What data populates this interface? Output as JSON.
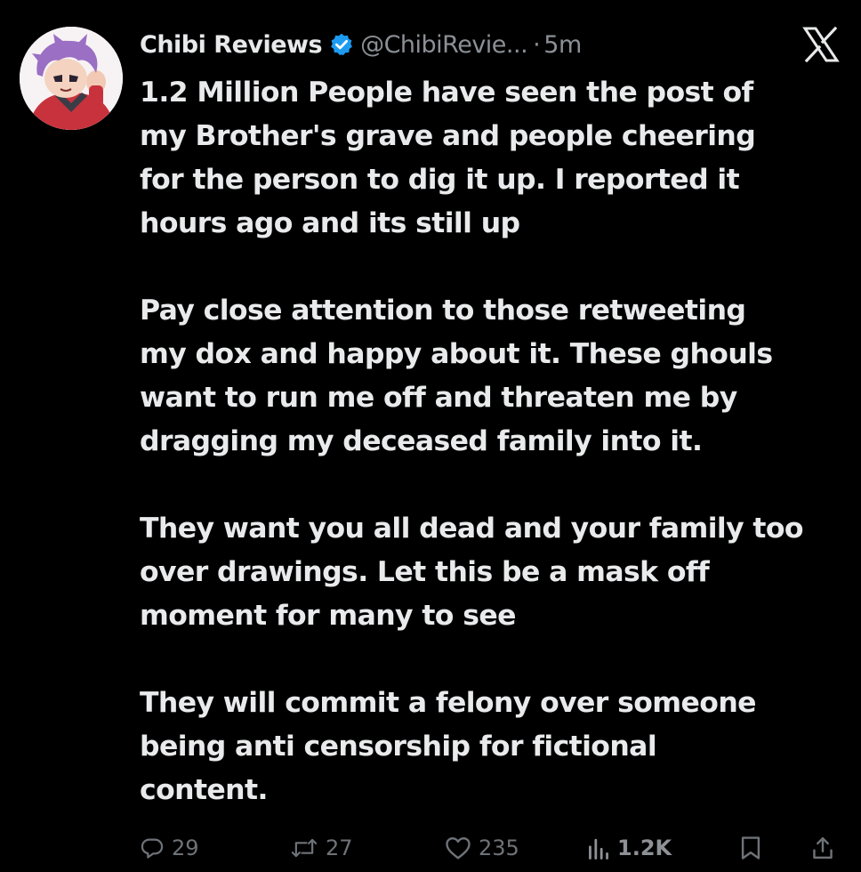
{
  "author": {
    "display_name": "Chibi Reviews",
    "handle": "@ChibiRevie...",
    "separator": "·",
    "time": "5m",
    "verified_icon": "verified-badge-icon",
    "verified_color": "#1d9bf0"
  },
  "platform": {
    "logo_icon": "x-logo-icon"
  },
  "tweet": {
    "paragraphs": [
      {
        "lines": [
          "1.2 Million People have seen the post of",
          "my Brother's grave and people cheering",
          "for the person to dig it up. I reported it",
          "hours ago and its still up"
        ]
      },
      {
        "lines": [
          "Pay close attention to those retweeting",
          "my dox and happy about it. These ghouls",
          "want to run me off and threaten me by",
          "dragging my deceased family into it."
        ]
      },
      {
        "lines": [
          "They want you all dead and your family too",
          "over drawings. Let this be a mask off",
          "moment for many to see"
        ]
      },
      {
        "lines": [
          "They will commit a felony over someone",
          "being anti censorship for fictional",
          "content."
        ]
      }
    ]
  },
  "actions": {
    "reply": {
      "icon": "reply-icon",
      "count": "29"
    },
    "retweet": {
      "icon": "retweet-icon",
      "count": "27"
    },
    "like": {
      "icon": "heart-icon",
      "count": "235"
    },
    "views": {
      "icon": "views-chart-icon",
      "count": "1.2K"
    },
    "bookmark": {
      "icon": "bookmark-icon"
    },
    "share": {
      "icon": "share-icon"
    }
  },
  "colors": {
    "background": "#000000",
    "text": "#e7e9ea",
    "secondary_text": "#8b9096",
    "action_icons": "#6e7378",
    "avatar_hair": "#9b6fc4",
    "avatar_jacket": "#c8323c"
  }
}
